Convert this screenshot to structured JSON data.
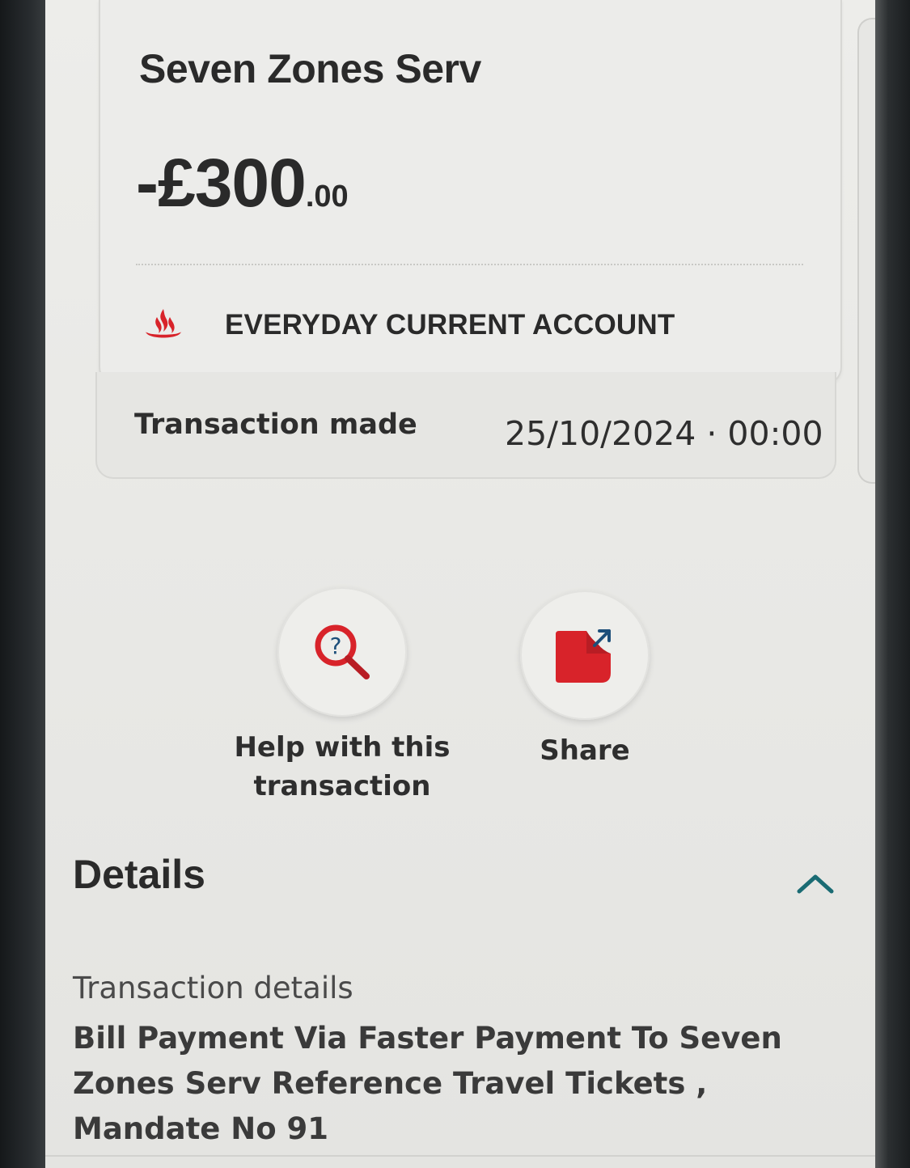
{
  "transaction": {
    "merchant": "Seven Zones Serv",
    "amount_main": "-£300",
    "amount_pence": ".00",
    "account": "EVERYDAY CURRENT ACCOUNT",
    "date_label": "Transaction made",
    "date_value": "25/10/2024 · 00:00"
  },
  "actions": {
    "help_label": "Help with this\ntransaction",
    "share_label": "Share"
  },
  "details": {
    "title": "Details",
    "subheading": "Transaction details",
    "text": "Bill Payment Via Faster Payment To Seven Zones Serv Reference Travel Tickets , Mandate No 91"
  },
  "colors": {
    "brand_red": "#d8232a",
    "accent_teal": "#1a6b73"
  },
  "icons": {
    "account": "santander-flame-icon",
    "help": "magnifier-question-icon",
    "share": "share-arrow-icon",
    "collapse": "chevron-up-icon"
  }
}
